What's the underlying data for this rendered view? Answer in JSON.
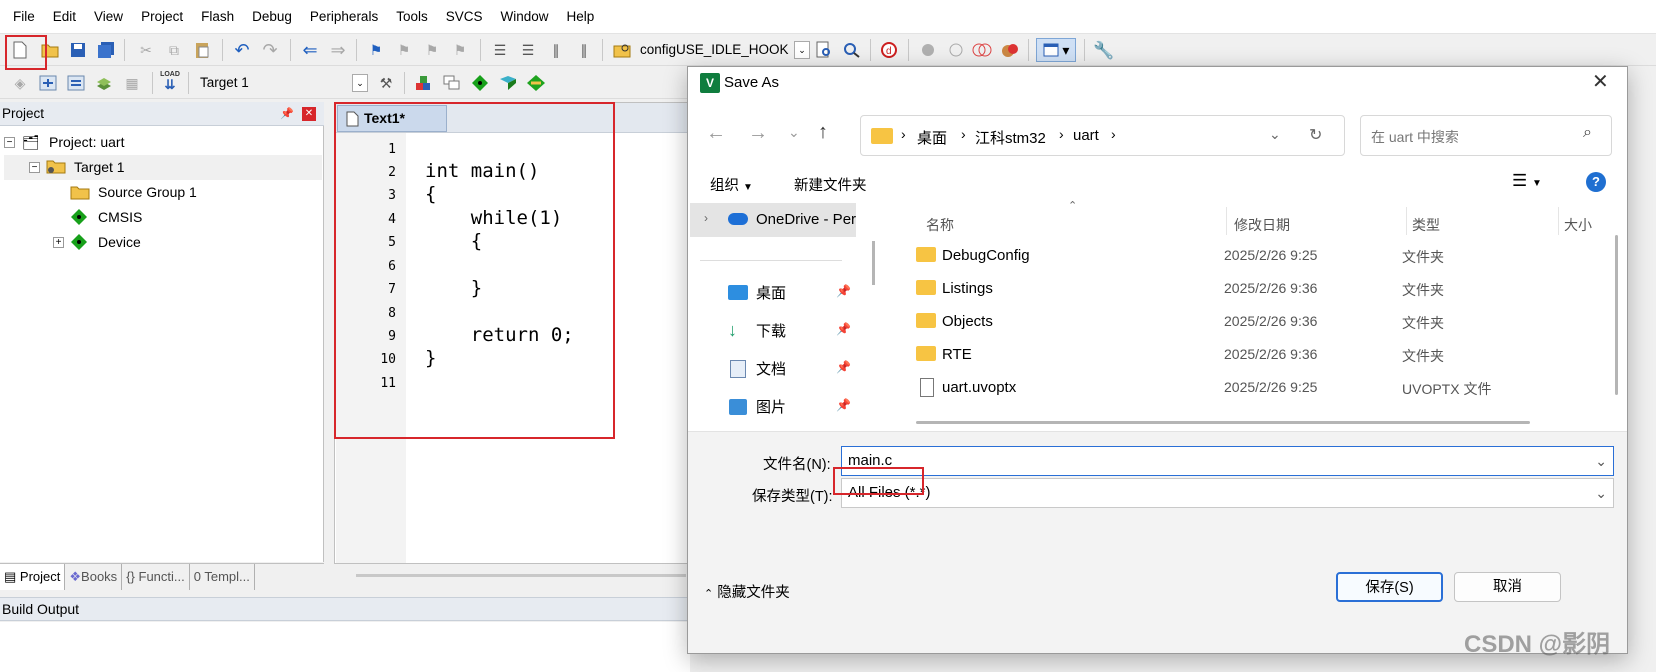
{
  "menu": [
    "File",
    "Edit",
    "View",
    "Project",
    "Flash",
    "Debug",
    "Peripherals",
    "Tools",
    "SVCS",
    "Window",
    "Help"
  ],
  "toolbar": {
    "define_combo": "configUSE_IDLE_HOOK",
    "target_combo": "Target 1",
    "load_label": "LOAD"
  },
  "project_pane": {
    "header": "Project",
    "tree": [
      {
        "label": "Project: uart"
      },
      {
        "label": "Target 1"
      },
      {
        "label": "Source Group 1"
      },
      {
        "label": "CMSIS"
      },
      {
        "label": "Device"
      }
    ],
    "tabs": [
      "Project",
      "Books",
      "Functi...",
      "Templ..."
    ]
  },
  "editor": {
    "tab": "Text1*",
    "line_numbers": [
      "1",
      "2",
      "3",
      "4",
      "5",
      "6",
      "7",
      "8",
      "9",
      "10",
      "11"
    ],
    "lines": [
      "",
      "int main()",
      "{",
      "    while(1)",
      "    {",
      "",
      "    }",
      "",
      "    return 0;",
      "}",
      ""
    ]
  },
  "build_output": {
    "title": "Build Output"
  },
  "dialog": {
    "title": "Save As",
    "path": [
      "桌面",
      "江科stm32",
      "uart"
    ],
    "search_placeholder": "在 uart 中搜索",
    "organize": "组织",
    "new_folder": "新建文件夹",
    "nav": [
      {
        "label": "OneDrive - Per"
      },
      {
        "label": "桌面"
      },
      {
        "label": "下载"
      },
      {
        "label": "文档"
      },
      {
        "label": "图片"
      }
    ],
    "columns": {
      "name": "名称",
      "modified": "修改日期",
      "type": "类型",
      "size": "大小"
    },
    "files": [
      {
        "name": "DebugConfig",
        "date": "2025/2/26 9:25",
        "type": "文件夹"
      },
      {
        "name": "Listings",
        "date": "2025/2/26 9:36",
        "type": "文件夹"
      },
      {
        "name": "Objects",
        "date": "2025/2/26 9:36",
        "type": "文件夹"
      },
      {
        "name": "RTE",
        "date": "2025/2/26 9:36",
        "type": "文件夹"
      },
      {
        "name": "uart.uvoptx",
        "date": "2025/2/26 9:25",
        "type": "UVOPTX 文件"
      }
    ],
    "filename_label": "文件名(N):",
    "filename_value": "main.c",
    "filetype_label": "保存类型(T):",
    "filetype_value": "All Files (*.*)",
    "hide_folders": "隐藏文件夹",
    "save": "保存(S)",
    "cancel": "取消"
  },
  "watermark": "CSDN @影阴"
}
